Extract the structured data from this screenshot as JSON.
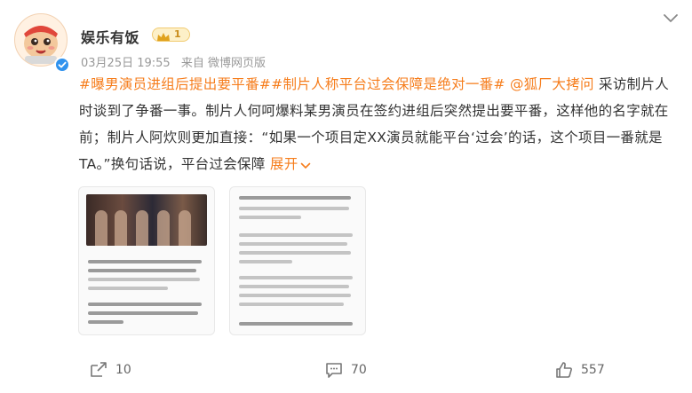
{
  "post": {
    "username": "娱乐有饭",
    "level": "1",
    "date": "03月25日 19:55",
    "source": "来自 微博网页版",
    "tag1": "#曝男演员进组后提出要平番#",
    "tag2": "#制片人称平台过会保障是绝对一番#",
    "mention": "@狐厂大拷问",
    "body": "采访制片人时谈到了争番一事。制片人何呵爆料某男演员在签约进组后突然提出要平番，这样他的名字就在前；制片人阿炊则更加直接：“如果一个项目定XX演员就能平台‘过会’的话，这个项目一番就是TA。”换句话说，平台过会保障",
    "expand_label": "展开"
  },
  "actions": {
    "repost_count": "10",
    "comment_count": "70",
    "like_count": "557"
  },
  "icons": {
    "menu": "chevron-down-icon",
    "repost": "repost-icon",
    "comment": "comment-icon",
    "like": "thumbs-up-icon",
    "verified": "verified-badge-icon",
    "crown": "crown-icon"
  },
  "colors": {
    "accent": "#f67d1c",
    "verified": "#2f92ee",
    "text": "#333333",
    "meta": "#999999"
  }
}
